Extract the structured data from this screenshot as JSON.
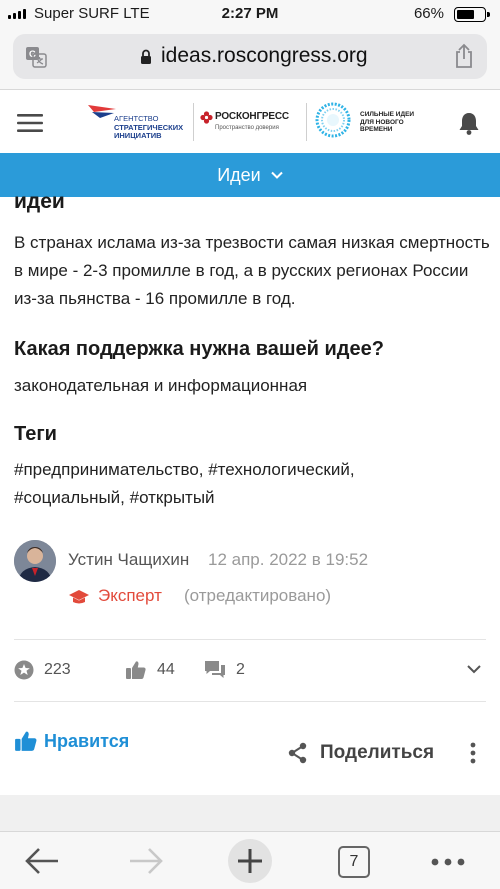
{
  "status_bar": {
    "carrier": "Super SURF  LTE",
    "time": "2:27 PM",
    "battery_percent": "66%",
    "battery_level": 0.66
  },
  "browser": {
    "url": "ideas.roscongress.org",
    "tabs_count": "7",
    "icons": [
      "translate-icon",
      "lock-icon",
      "share-icon",
      "back-arrow-icon",
      "forward-arrow-icon",
      "new-tab-icon",
      "tabs-icon",
      "more-icon"
    ]
  },
  "header": {
    "logo_asi_lines": [
      "АГЕНТСТВО",
      "СТРАТЕГИЧЕСКИХ",
      "ИНИЦИАТИВ"
    ],
    "logo_rk_name": "РОСКОНГРЕСС",
    "logo_rk_sub": "Пространство доверия",
    "logo_si_lines": [
      "СИЛЬНЫЕ ИДЕИ",
      "ДЛЯ НОВОГО",
      "ВРЕМЕНИ"
    ]
  },
  "nav": {
    "ideas_label": "Идеи"
  },
  "content": {
    "partial_title": "идеи",
    "description": "В странах ислама из-за трезвости самая низкая смертность в мире - 2-3 промилле в год, а в русских регионах России из-за пьянства - 16 промилле в год.",
    "support_title": "Какая поддержка нужна вашей идее?",
    "support_text": "законодательная и информационная",
    "tags_title": "Теги",
    "tags_text": "#предпринимательство, #технологический, #социальный, #открытый"
  },
  "author": {
    "name": "Устин Чащихин",
    "date": "12 апр. 2022 в 19:52",
    "role": "Эксперт",
    "edited": "(отредактировано)"
  },
  "stats": {
    "rating": "223",
    "likes": "44",
    "comments": "2"
  },
  "actions": {
    "like_label": "Нравится",
    "share_label": "Поделиться"
  },
  "colors": {
    "accent_blue": "#2b9bd9",
    "like_blue": "#1f8fd6",
    "expert_red": "#e24a3b"
  }
}
